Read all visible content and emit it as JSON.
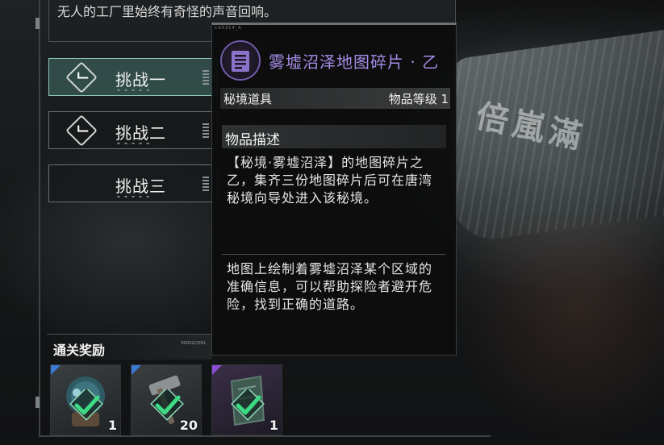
{
  "scene": {
    "wreck_sign": "倍嵐滿"
  },
  "quest": {
    "description": "无人的工厂里始终有奇怪的声音回响。"
  },
  "challenges": [
    {
      "label": "挑战一",
      "sub": "▬ ▬ ▬ ▬ ▬",
      "completed": true,
      "active": true
    },
    {
      "label": "挑战二",
      "sub": "▬ ▬ ▬ ▬ ▬",
      "completed": true,
      "active": false
    },
    {
      "label": "挑战三",
      "sub": "▬ ▬ ▬ ▬ ▬",
      "completed": false,
      "active": false
    }
  ],
  "rewards": {
    "title": "通关奖励",
    "code": "00002///001",
    "items": [
      {
        "icon": "helmet-icon",
        "quantity": "1",
        "rarity_color": "#3b7bd4"
      },
      {
        "icon": "hammer-icon",
        "quantity": "20",
        "rarity_color": "#3b7bd4"
      },
      {
        "icon": "map-fragment-icon",
        "quantity": "1",
        "rarity_color": "#8a4fd6"
      }
    ]
  },
  "tooltip": {
    "tag": "CA0314_A",
    "icon": "document-icon",
    "title": "雾墟沼泽地图碎片 · 乙",
    "title_color": "#a48ce6",
    "category": "秘境道具",
    "level_label": "物品等级 1",
    "section_title": "物品描述",
    "paragraph1": "【秘境·雾墟沼泽】的地图碎片之乙，集齐三份地图碎片后可在唐湾秘境向导处进入该秘境。",
    "paragraph2": "地图上绘制着雾墟沼泽某个区域的准确信息，可以帮助探险者避开危险，找到正确的道路。"
  },
  "colors": {
    "accent_teal": "#8fc7b9",
    "check_green": "#3ddc84"
  }
}
